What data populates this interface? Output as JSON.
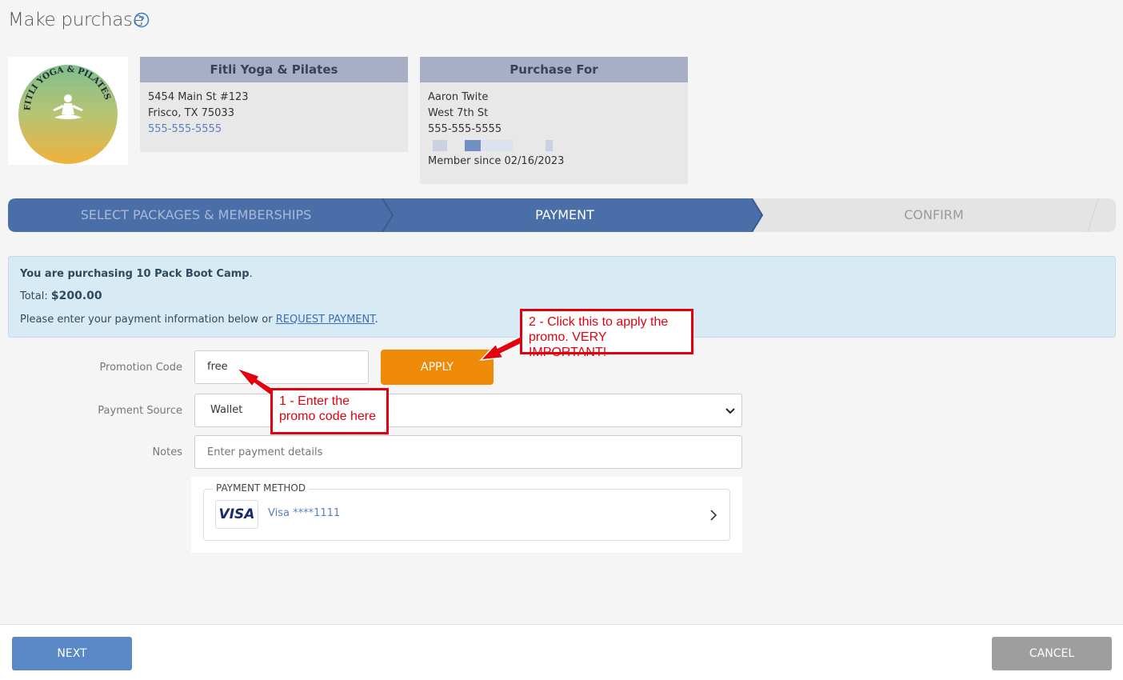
{
  "page": {
    "title": "Make purchase"
  },
  "studio": {
    "name": "Fitli Yoga & Pilates",
    "address_line1": "5454 Main St #123",
    "address_line2": "Frisco, TX 75033",
    "phone": "555-555-5555",
    "logo_text": "FITLI YOGA & PILATES"
  },
  "purchase_for": {
    "heading": "Purchase For",
    "name": "Aaron Twite",
    "street": "West 7th St",
    "phone": "555-555-5555",
    "member_since": "Member since 02/16/2023"
  },
  "steps": [
    {
      "label": "SELECT PACKAGES & MEMBERSHIPS",
      "state": "done"
    },
    {
      "label": "PAYMENT",
      "state": "active"
    },
    {
      "label": "CONFIRM",
      "state": "pending"
    }
  ],
  "info": {
    "purchasing_prefix": "You are purchasing ",
    "purchasing_item": "10 Pack Boot Camp",
    "purchasing_suffix": ".",
    "total_label": "Total: ",
    "total_value": "$200.00",
    "instructions_prefix": "Please enter your payment information below or ",
    "request_payment_link": "REQUEST PAYMENT",
    "instructions_suffix": "."
  },
  "form": {
    "promo_label": "Promotion Code",
    "promo_value": "free",
    "apply_label": "APPLY",
    "source_label": "Payment Source",
    "source_value": "Wallet",
    "notes_label": "Notes",
    "notes_placeholder": "Enter payment details"
  },
  "payment_method": {
    "legend": "PAYMENT METHOD",
    "card_brand": "VISA",
    "card_text": "Visa ****1111"
  },
  "callouts": {
    "one_line1": "1 - Enter the",
    "one_line2": "promo code here",
    "two_line1": "2 - Click this to apply the",
    "two_line2": "promo. VERY IMPORTANT!"
  },
  "footer": {
    "next_label": "NEXT",
    "cancel_label": "CANCEL"
  },
  "colors": {
    "step_active": "#4a6ea8",
    "step_pending": "#e4e4e4",
    "apply": "#ef8a07",
    "next": "#5a87c5",
    "cancel": "#9e9e9e",
    "callout": "#e3000f"
  }
}
